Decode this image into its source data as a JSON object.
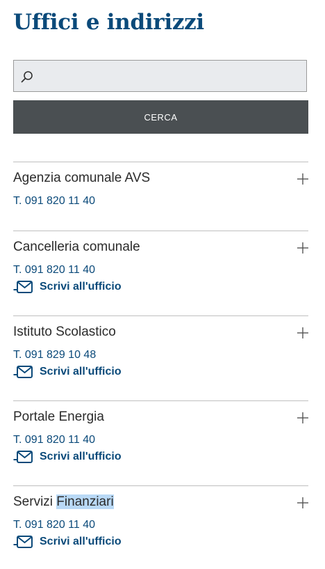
{
  "page": {
    "title": "Uffici e indirizzi"
  },
  "search": {
    "placeholder": "",
    "value": "",
    "button_label": "CERCA"
  },
  "offices": [
    {
      "name": "Agenzia comunale AVS",
      "phone": "T. 091 820 11 40"
    },
    {
      "name": "Cancelleria comunale",
      "phone": "T. 091 820 11 40",
      "write_label": "Scrivi all'ufficio"
    },
    {
      "name": "Istituto Scolastico",
      "phone": "T. 091 829 10 48",
      "write_label": "Scrivi all'ufficio"
    },
    {
      "name": "Portale Energia",
      "phone": "T. 091 820 11 40",
      "write_label": "Scrivi all'ufficio"
    },
    {
      "name_plain": "Servizi",
      "name_selected": "Finanziari",
      "phone": "T. 091 820 11 40",
      "write_label": "Scrivi all'ufficio"
    }
  ],
  "colors": {
    "title": "#0b4a7a",
    "link": "#0b4a7a",
    "button": "#4a4f52",
    "selection": "#b9d9f6"
  }
}
